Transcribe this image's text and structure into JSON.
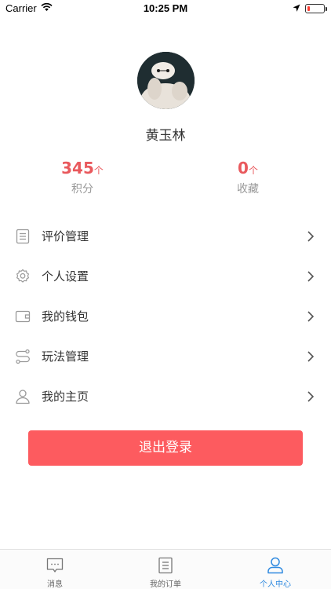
{
  "status_bar": {
    "carrier": "Carrier",
    "time": "10:25 PM",
    "battery_level": 0.1
  },
  "profile": {
    "avatar_icon": "avatar-baymax",
    "username": "黄玉林"
  },
  "stats": [
    {
      "value": "345",
      "unit": "个",
      "label": "积分"
    },
    {
      "value": "0",
      "unit": "个",
      "label": "收藏"
    }
  ],
  "menu": {
    "items": [
      {
        "label": "评价管理",
        "icon": "list-icon"
      },
      {
        "label": "个人设置",
        "icon": "gear-icon"
      },
      {
        "label": "我的钱包",
        "icon": "wallet-icon"
      },
      {
        "label": "玩法管理",
        "icon": "route-icon"
      },
      {
        "label": "我的主页",
        "icon": "user-icon"
      }
    ]
  },
  "logout_label": "退出登录",
  "tabbar": {
    "tabs": [
      {
        "label": "消息",
        "icon": "message-icon",
        "active": false
      },
      {
        "label": "我的订单",
        "icon": "order-icon",
        "active": false
      },
      {
        "label": "个人中心",
        "icon": "person-icon",
        "active": true
      }
    ]
  },
  "colors": {
    "accent": "#fd5b5f",
    "stat_red": "#e9595d",
    "tab_active": "#2f8ae0"
  }
}
